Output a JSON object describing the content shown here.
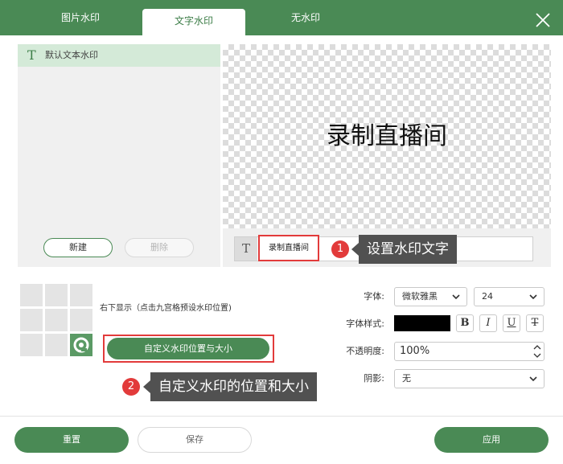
{
  "tabs": [
    {
      "label": "图片水印"
    },
    {
      "label": "文字水印"
    },
    {
      "label": "无水印"
    }
  ],
  "list": {
    "items": [
      {
        "label": "默认文本水印"
      }
    ],
    "new_label": "新建",
    "delete_label": "删除"
  },
  "preview": {
    "text": "录制直播间"
  },
  "text_input": {
    "value": "录制直播间"
  },
  "callouts": {
    "one": {
      "number": "1",
      "text": "设置水印文字"
    },
    "two": {
      "number": "2",
      "text": "自定义水印的位置和大小"
    }
  },
  "position": {
    "label": "右下显示（点击九宫格预设水印位置)",
    "custom_button": "自定义水印位置与大小"
  },
  "form": {
    "font_label": "字体:",
    "font_value": "微软雅黑",
    "size_value": "24",
    "style_label": "字体样式:",
    "color": "#000000",
    "bold": "B",
    "italic": "I",
    "underline": "U",
    "strike": "T",
    "opacity_label": "不透明度:",
    "opacity_value": "100%",
    "shadow_label": "阴影:",
    "shadow_value": "无"
  },
  "footer": {
    "reset": "重置",
    "save": "保存",
    "apply": "应用"
  },
  "colors": {
    "accent": "#4a8a55",
    "highlight": "#e23b3b",
    "callout_bg": "#515151",
    "selected_row": "#d4ead8"
  },
  "icons": {
    "close": "close-icon",
    "text_type": "text-type-icon",
    "chevron": "chevron-down-icon",
    "watermark_logo": "watermark-logo-icon"
  }
}
